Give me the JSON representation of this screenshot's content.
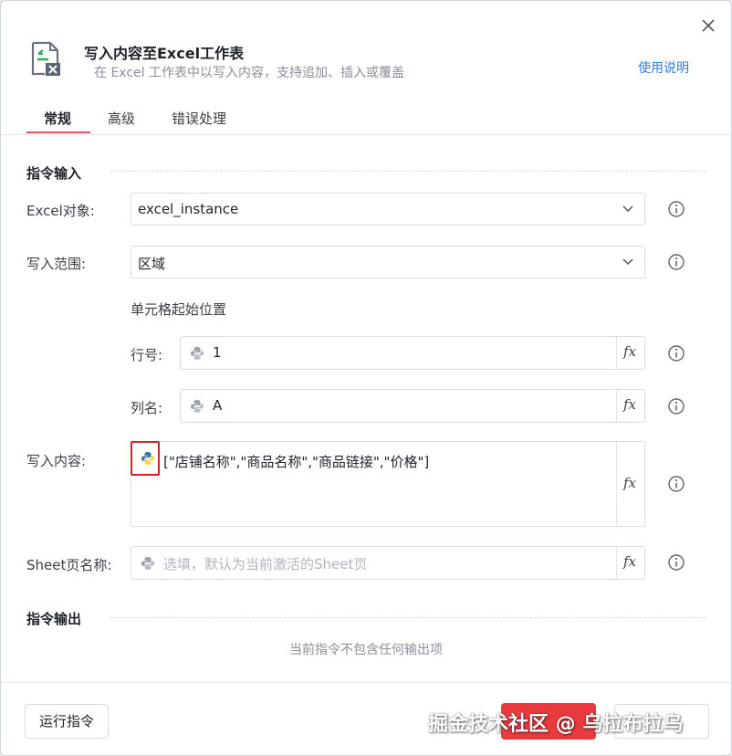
{
  "dialog": {
    "title": "写入内容至Excel工作表",
    "subtitle": "在 Excel 工作表中以写入内容，支持追加、插入或覆盖",
    "help_link": "使用说明"
  },
  "tabs": [
    {
      "label": "常规",
      "active": true
    },
    {
      "label": "高级",
      "active": false
    },
    {
      "label": "错误处理",
      "active": false
    }
  ],
  "input_section": {
    "title": "指令输入",
    "excel_object": {
      "label": "Excel对象:",
      "value": "excel_instance"
    },
    "write_range": {
      "label": "写入范围:",
      "value": "区域"
    },
    "cell_start": {
      "label": "单元格起始位置",
      "row": {
        "label": "行号:",
        "value": "1"
      },
      "column": {
        "label": "列名:",
        "value": "A"
      }
    },
    "write_content": {
      "label": "写入内容:",
      "value": "[\"店铺名称\",\"商品名称\",\"商品链接\",\"价格\"]"
    },
    "sheet_name": {
      "label": "Sheet页名称:",
      "placeholder": "选填，默认为当前激活的Sheet页"
    },
    "fx_label": "fx"
  },
  "output_section": {
    "title": "指令输出",
    "empty_text": "当前指令不包含任何输出项"
  },
  "footer": {
    "run_button": "运行指令",
    "watermark": "掘金技术社区 @ 乌拉布拉乌"
  },
  "icons": {
    "close": "close-icon",
    "header": "excel-write-icon",
    "chevron": "chevron-down-icon",
    "info": "info-icon",
    "python": "python-icon"
  },
  "colors": {
    "accent_red": "#e8515a",
    "link_blue": "#2f7de1",
    "primary_button": "#e83a3f",
    "highlight_box": "#e02020"
  }
}
